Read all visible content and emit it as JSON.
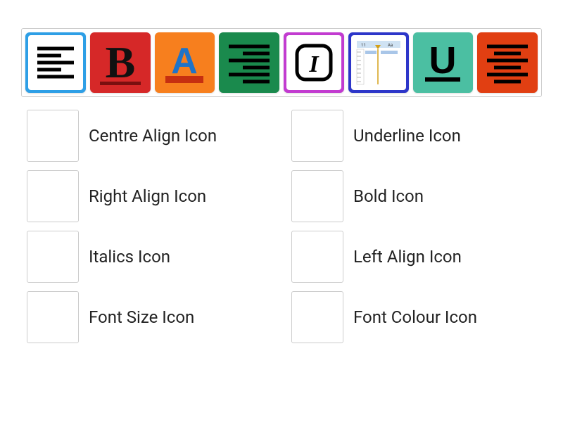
{
  "tray": {
    "tiles": [
      {
        "name": "left-align-icon",
        "bg": "bg-blue"
      },
      {
        "name": "bold-icon",
        "bg": "bg-red"
      },
      {
        "name": "font-colour-icon",
        "bg": "bg-orange"
      },
      {
        "name": "right-align-icon",
        "bg": "bg-green"
      },
      {
        "name": "italics-icon",
        "bg": "bg-magenta"
      },
      {
        "name": "font-size-icon",
        "bg": "bg-indigo"
      },
      {
        "name": "underline-icon",
        "bg": "bg-cyan"
      },
      {
        "name": "centre-align-icon",
        "bg": "bg-redorange"
      }
    ]
  },
  "answers": [
    {
      "label": "Centre Align Icon"
    },
    {
      "label": "Underline Icon"
    },
    {
      "label": "Right Align Icon"
    },
    {
      "label": "Bold Icon"
    },
    {
      "label": "Italics Icon"
    },
    {
      "label": "Left Align Icon"
    },
    {
      "label": "Font Size Icon"
    },
    {
      "label": "Font Colour Icon"
    }
  ]
}
